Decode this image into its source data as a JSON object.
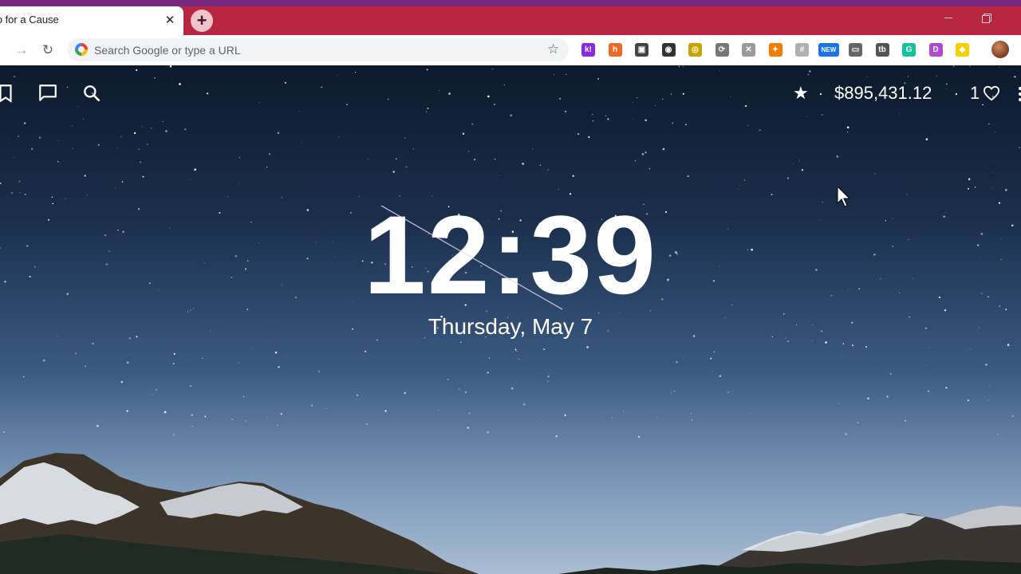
{
  "tab": {
    "title": "Tab for a Cause",
    "close": "✕"
  },
  "newtab": {
    "symbol": "+"
  },
  "toolbar": {
    "forward": "→",
    "reload": "↻",
    "bookmark": "☆"
  },
  "omnibox": {
    "placeholder": "Search Google or type a URL",
    "value": ""
  },
  "extensions": [
    {
      "name": "k-extension-icon",
      "label": "k!",
      "color": "#8a2be2"
    },
    {
      "name": "honey-extension-icon",
      "label": "h",
      "color": "#f06a26"
    },
    {
      "name": "camera-extension-icon",
      "label": "▣",
      "color": "#444444"
    },
    {
      "name": "target-extension-icon",
      "label": "◉",
      "color": "#333333"
    },
    {
      "name": "circle-extension-icon",
      "label": "◎",
      "color": "#c9a400"
    },
    {
      "name": "puzzle-extension-icon",
      "label": "⟳",
      "color": "#777777"
    },
    {
      "name": "x-extension-icon",
      "label": "✕",
      "color": "#9a9a9a"
    },
    {
      "name": "flame-extension-icon",
      "label": "✦",
      "color": "#f57c00"
    },
    {
      "name": "gray-extension-icon",
      "label": "#",
      "color": "#b0b0b0"
    },
    {
      "name": "new-extension-icon",
      "label": "NEW",
      "color": "#1a73e8"
    },
    {
      "name": "window-extension-icon",
      "label": "▭",
      "color": "#666666"
    },
    {
      "name": "tb-extension-icon",
      "label": "tb",
      "color": "#555555"
    },
    {
      "name": "grammarly-extension-icon",
      "label": "G",
      "color": "#15c39a"
    },
    {
      "name": "d-extension-icon",
      "label": "D",
      "color": "#b04ad6"
    },
    {
      "name": "snapchat-extension-icon",
      "label": "◆",
      "color": "#f7d000"
    }
  ],
  "header": {
    "money": "$895,431.12",
    "dot": "·",
    "hearts": "1",
    "star": "★"
  },
  "clock": {
    "time": "12:39",
    "date": "Thursday, May 7"
  }
}
